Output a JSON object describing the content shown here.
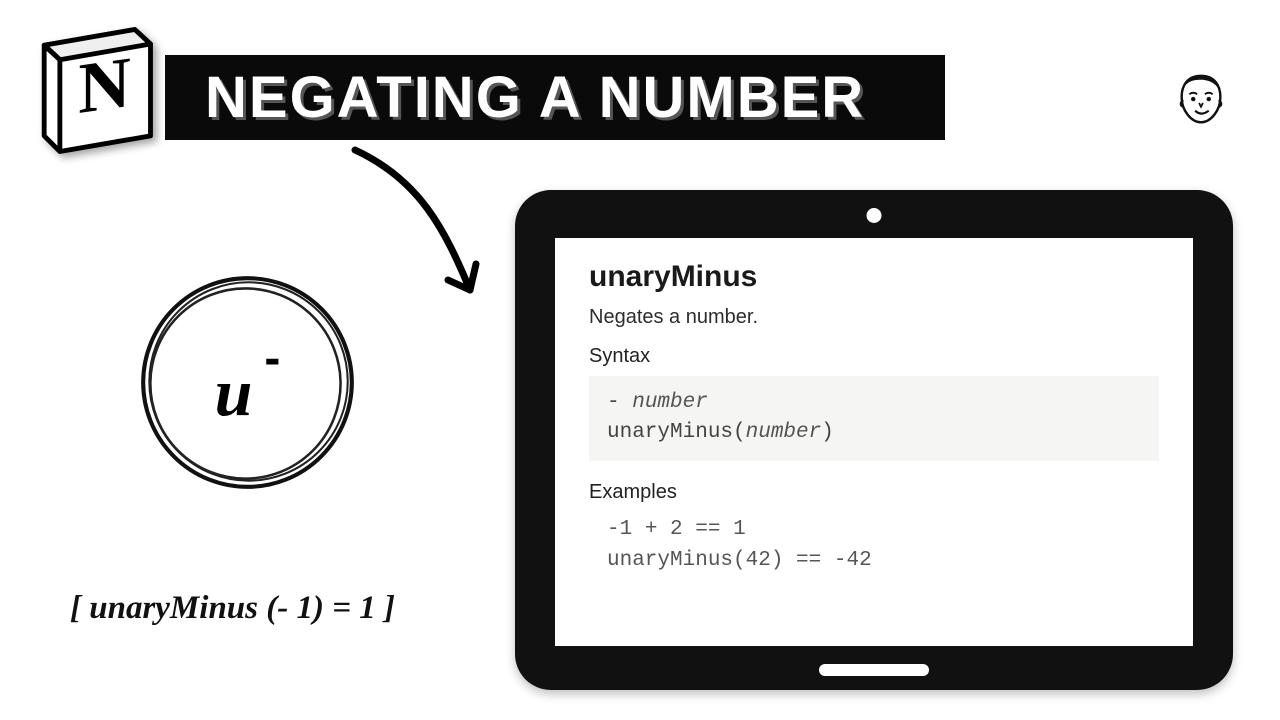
{
  "header": {
    "title": "NEGATING A NUMBER",
    "logo_letter": "N"
  },
  "badge": {
    "letter": "u",
    "superscript": "-"
  },
  "caption": "[ unaryMinus (- 1) = 1 ]",
  "doc": {
    "title": "unaryMinus",
    "description": "Negates a number.",
    "syntax_label": "Syntax",
    "syntax_line1_dash": "- ",
    "syntax_line1_ital": "number",
    "syntax_line2_pre": "unaryMinus(",
    "syntax_line2_ital": "number",
    "syntax_line2_post": ")",
    "examples_label": "Examples",
    "ex1_a": "-1",
    "ex1_b": " + ",
    "ex1_c": "2",
    "ex1_d": " == ",
    "ex1_e": "1",
    "ex2_a": "unaryMinus(",
    "ex2_b": "42",
    "ex2_c": ") == ",
    "ex2_d": "-42"
  }
}
